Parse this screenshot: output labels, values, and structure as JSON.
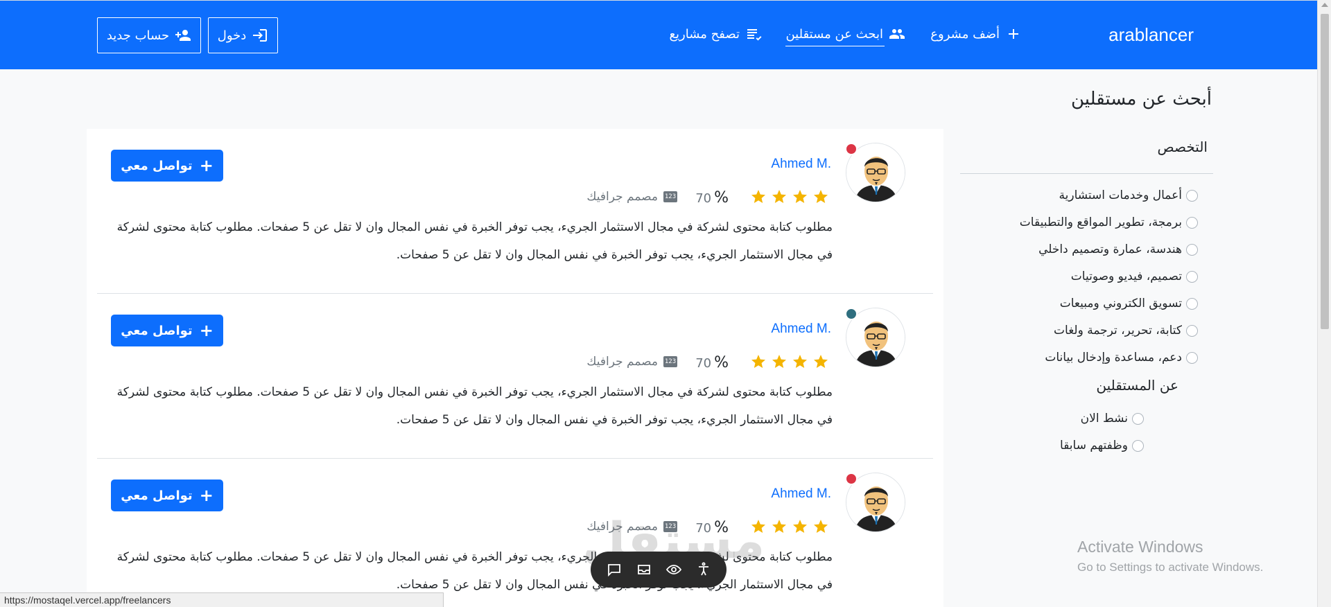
{
  "navbar": {
    "brand": "arablancer",
    "add_project": "أضف مشروع",
    "find_freelancers": "ابحث عن مستقلين",
    "browse_projects": "تصفح مشاريع",
    "login": "دخول",
    "signup": "حساب جديد",
    "color": "#0d6efd"
  },
  "sidebar": {
    "title": "أبحث عن مستقلين",
    "specialization_title": "التخصص",
    "specializations": [
      "أعمال وخدمات استشارية",
      "برمجة، تطوير المواقع والتطبيقات",
      "هندسة، عمارة وتصميم داخلي",
      "تصميم، فيديو وصوتيات",
      "تسويق الكتروني ومبيعات",
      "كتابة، تحرير، ترجمة ولغات",
      "دعم، مساعدة وإدخال بيانات"
    ],
    "about_title": "عن المستقلين",
    "about_options": [
      "نشط الان",
      "وظفتهم سابقا"
    ]
  },
  "freelancers": [
    {
      "name": "Ahmed M.",
      "status_color": "#dc3545",
      "rating": 4,
      "percent": "70",
      "percent_sign": "%",
      "role": "مصمم جرافيك",
      "role_icon": "123",
      "description": "مطلوب كتابة محتوى لشركة في مجال الاستثمار الجريء، يجب توفر الخبرة في نفس المجال وان لا تقل عن 5 صفحات. مطلوب كتابة محتوى لشركة في مجال الاستثمار الجريء، يجب توفر الخبرة في نفس المجال وان لا تقل عن 5 صفحات.",
      "contact": "تواصل معي"
    },
    {
      "name": "Ahmed M.",
      "status_color": "#2f6f7f",
      "rating": 4,
      "percent": "70",
      "percent_sign": "%",
      "role": "مصمم جرافيك",
      "role_icon": "123",
      "description": "مطلوب كتابة محتوى لشركة في مجال الاستثمار الجريء، يجب توفر الخبرة في نفس المجال وان لا تقل عن 5 صفحات. مطلوب كتابة محتوى لشركة في مجال الاستثمار الجريء، يجب توفر الخبرة في نفس المجال وان لا تقل عن 5 صفحات.",
      "contact": "تواصل معي"
    },
    {
      "name": "Ahmed M.",
      "status_color": "#dc3545",
      "rating": 4,
      "percent": "70",
      "percent_sign": "%",
      "role": "مصمم جرافيك",
      "role_icon": "123",
      "description": "مطلوب كتابة محتوى لشركة في مجال الاستثمار الجريء، يجب توفر الخبرة في نفس المجال وان لا تقل عن 5 صفحات. مطلوب كتابة محتوى لشركة في مجال الاستثمار الجريء، يجب توفر الخبرة في نفس المجال وان لا تقل عن 5 صفحات.",
      "contact": "تواصل معي"
    }
  ],
  "overlay": {
    "activate_title": "Activate Windows",
    "activate_subtitle": "Go to Settings to activate Windows.",
    "watermark": "مستقل",
    "toolbar_icons": [
      "chat-icon",
      "inbox-icon",
      "eye-icon",
      "accessibility-icon"
    ]
  },
  "statusbar": {
    "url": "https://mostaqel.vercel.app/freelancers"
  }
}
